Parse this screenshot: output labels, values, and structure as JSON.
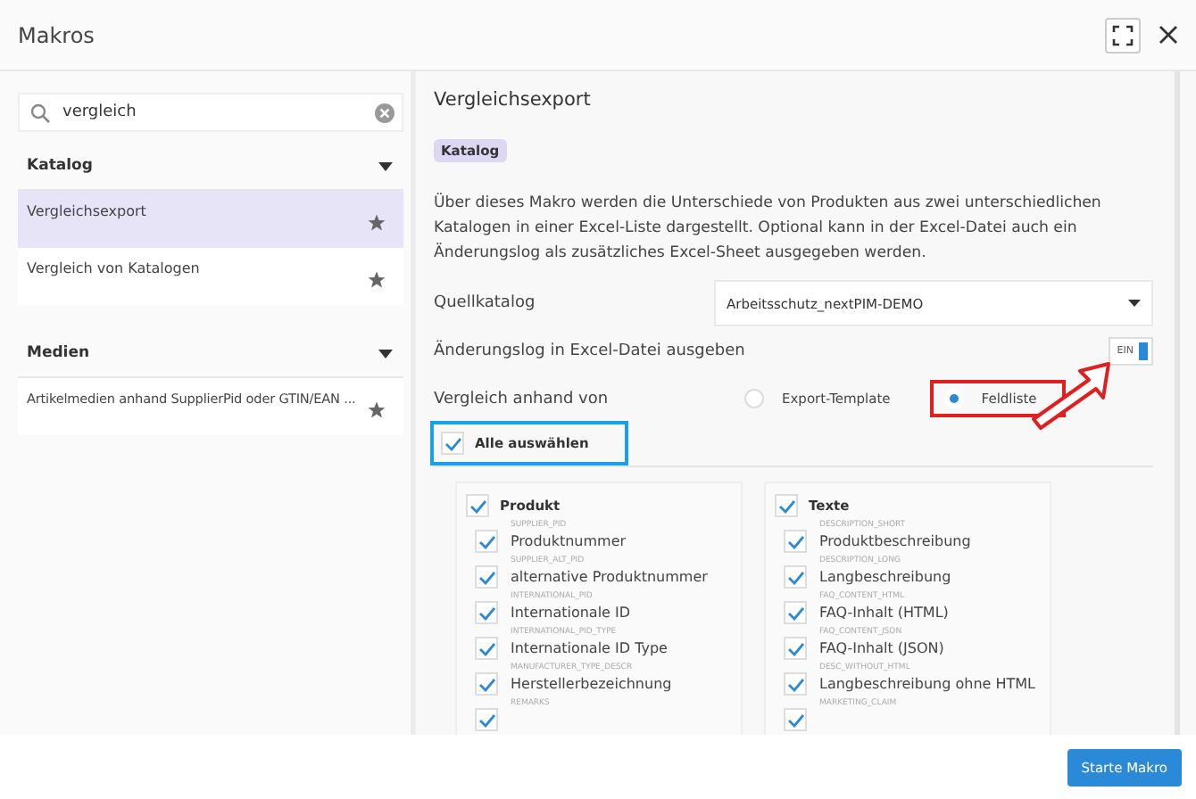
{
  "window": {
    "title": "Makros"
  },
  "search": {
    "value": "vergleich"
  },
  "sidebar": {
    "groups": [
      {
        "title": "Katalog",
        "expanded": true,
        "items": [
          {
            "label": "Vergleichsexport",
            "selected": true
          },
          {
            "label": "Vergleich von Katalogen",
            "selected": false
          }
        ]
      },
      {
        "title": "Medien",
        "expanded": true,
        "items": [
          {
            "label": "Artikelmedien anhand SupplierPid oder GTIN/EAN ...",
            "selected": false
          }
        ]
      }
    ]
  },
  "detail": {
    "title": "Vergleichsexport",
    "badge": "Katalog",
    "description": "Über dieses Makro werden die Unterschiede von Produkten aus zwei unterschiedlichen Katalogen in einer Excel-Liste dargestellt. Optional kann in der Excel-Datei auch ein Änderungslog als zusätzliches Excel-Sheet ausgegeben werden.",
    "source_catalog": {
      "label": "Quellkatalog",
      "value": "Arbeitsschutz_nextPIM-DEMO"
    },
    "changelog": {
      "label": "Änderungslog in Excel-Datei ausgeben",
      "toggle_text": "EIN",
      "on": true
    },
    "compare_by": {
      "label": "Vergleich anhand von",
      "options": [
        {
          "label": "Export-Template",
          "selected": false,
          "highlighted": false
        },
        {
          "label": "Feldliste",
          "selected": true,
          "highlighted": true
        }
      ]
    },
    "select_all": {
      "label": "Alle auswählen",
      "checked": true,
      "highlighted": true
    },
    "field_groups": [
      {
        "title": "Produkt",
        "checked": true,
        "fields": [
          {
            "code": "SUPPLIER_PID",
            "label": "Produktnummer",
            "checked": true
          },
          {
            "code": "SUPPLIER_ALT_PID",
            "label": "alternative Produktnummer",
            "checked": true
          },
          {
            "code": "INTERNATIONAL_PID",
            "label": "Internationale ID",
            "checked": true
          },
          {
            "code": "INTERNATIONAL_PID_TYPE",
            "label": "Internationale ID Type",
            "checked": true
          },
          {
            "code": "MANUFACTURER_TYPE_DESCR",
            "label": "Herstellerbezeichnung",
            "checked": true
          },
          {
            "code": "REMARKS",
            "checked": true
          }
        ]
      },
      {
        "title": "Texte",
        "checked": true,
        "fields": [
          {
            "code": "DESCRIPTION_SHORT",
            "label": "Produktbeschreibung",
            "checked": true
          },
          {
            "code": "DESCRIPTION_LONG",
            "label": "Langbeschreibung",
            "checked": true
          },
          {
            "code": "FAQ_CONTENT_HTML",
            "label": "FAQ-Inhalt (HTML)",
            "checked": true
          },
          {
            "code": "FAQ_CONTENT_JSON",
            "label": "FAQ-Inhalt (JSON)",
            "checked": true
          },
          {
            "code": "DESC_WITHOUT_HTML",
            "label": "Langbeschreibung ohne HTML",
            "checked": true
          },
          {
            "code": "MARKETING_CLAIM",
            "checked": true
          }
        ]
      }
    ]
  },
  "start_button": "Starte Makro"
}
